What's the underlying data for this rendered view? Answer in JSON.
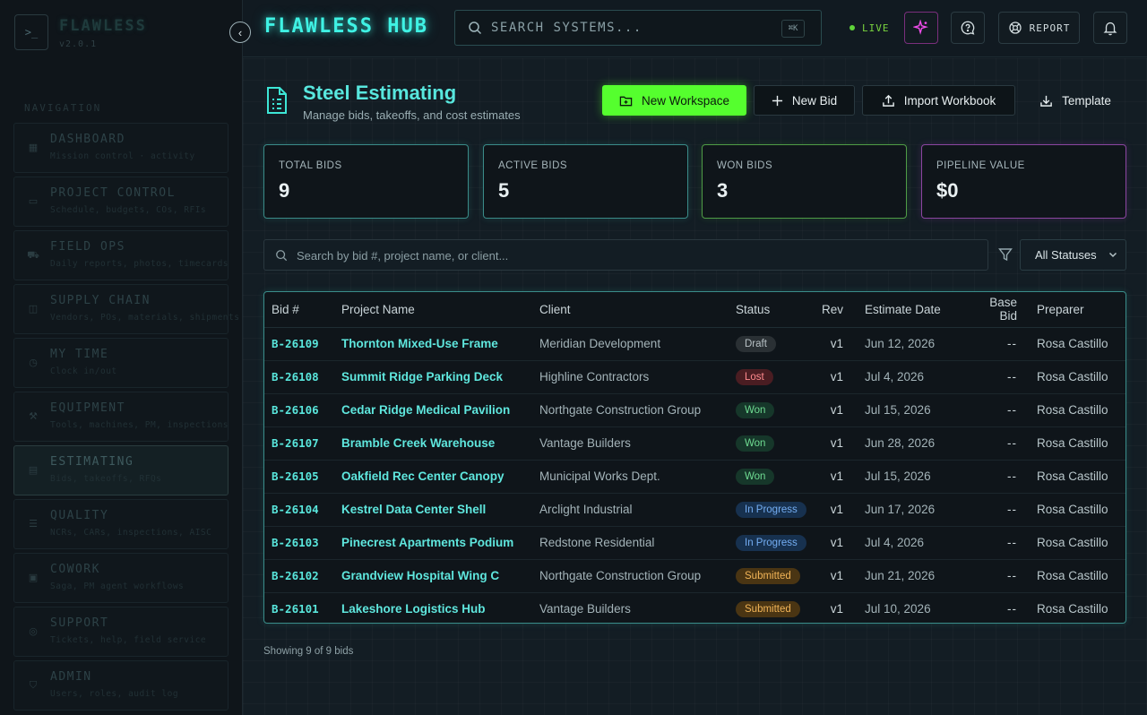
{
  "sidebar": {
    "brand_glyph": ">_",
    "brand_name": "FLAWLESS",
    "version": "v2.0.1",
    "collapse_glyph": "‹",
    "nav_heading": "NAVIGATION",
    "items": [
      {
        "label": "DASHBOARD",
        "sub": "Mission control · activity",
        "icon": "grid-icon"
      },
      {
        "label": "PROJECT CONTROL",
        "sub": "Schedule, budgets, COs, RFIs",
        "icon": "folder-icon"
      },
      {
        "label": "FIELD OPS",
        "sub": "Daily reports, photos, timecards",
        "icon": "truck-icon"
      },
      {
        "label": "SUPPLY CHAIN",
        "sub": "Vendors, POs, materials, shipments",
        "icon": "box-icon"
      },
      {
        "label": "MY TIME",
        "sub": "Clock in/out",
        "icon": "clock-icon"
      },
      {
        "label": "EQUIPMENT",
        "sub": "Tools, machines, PM, inspections",
        "icon": "wrench-icon"
      },
      {
        "label": "ESTIMATING",
        "sub": "Bids, takeoffs, RFQs",
        "icon": "document-icon"
      },
      {
        "label": "QUALITY",
        "sub": "NCRs, CARs, inspections, AISC",
        "icon": "checklist-icon"
      },
      {
        "label": "COWORK",
        "sub": "Saga, PM agent workflows",
        "icon": "briefcase-icon"
      },
      {
        "label": "SUPPORT",
        "sub": "Tickets, help, field service",
        "icon": "lifebuoy-icon"
      },
      {
        "label": "ADMIN",
        "sub": "Users, roles, audit log",
        "icon": "shield-icon"
      }
    ]
  },
  "topbar": {
    "title": "FLAWLESS HUB",
    "search_placeholder": "SEARCH SYSTEMS...",
    "shortcut": "⌘K",
    "live_label": "LIVE",
    "report_label": "REPORT"
  },
  "page": {
    "title": "Steel Estimating",
    "subtitle": "Manage bids, takeoffs, and cost estimates",
    "actions": {
      "new_workspace": "New Workspace",
      "new_bid": "New Bid",
      "import_workbook": "Import Workbook",
      "template": "Template"
    }
  },
  "stats": [
    {
      "label": "TOTAL BIDS",
      "value": "9",
      "accent": "#3fd6cc"
    },
    {
      "label": "ACTIVE BIDS",
      "value": "5",
      "accent": "#3fd6cc"
    },
    {
      "label": "WON BIDS",
      "value": "3",
      "accent": "#5ee04a"
    },
    {
      "label": "PIPELINE VALUE",
      "value": "$0",
      "accent": "#c64ff0"
    }
  ],
  "filters": {
    "search_placeholder": "Search by bid #, project name, or client...",
    "status_selected": "All Statuses"
  },
  "table": {
    "columns": [
      "Bid #",
      "Project Name",
      "Client",
      "Status",
      "Rev",
      "Estimate Date",
      "Base Bid",
      "Preparer"
    ],
    "rows": [
      {
        "bid": "B-26109",
        "project": "Thornton Mixed-Use Frame",
        "client": "Meridian Development",
        "status": "Draft",
        "status_class": "b-draft",
        "rev": "v1",
        "date": "Jun 12, 2026",
        "base": "--",
        "preparer": "Rosa Castillo"
      },
      {
        "bid": "B-26108",
        "project": "Summit Ridge Parking Deck",
        "client": "Highline Contractors",
        "status": "Lost",
        "status_class": "b-lost",
        "rev": "v1",
        "date": "Jul 4, 2026",
        "base": "--",
        "preparer": "Rosa Castillo"
      },
      {
        "bid": "B-26106",
        "project": "Cedar Ridge Medical Pavilion",
        "client": "Northgate Construction Group",
        "status": "Won",
        "status_class": "b-won",
        "rev": "v1",
        "date": "Jul 15, 2026",
        "base": "--",
        "preparer": "Rosa Castillo"
      },
      {
        "bid": "B-26107",
        "project": "Bramble Creek Warehouse",
        "client": "Vantage Builders",
        "status": "Won",
        "status_class": "b-won",
        "rev": "v1",
        "date": "Jun 28, 2026",
        "base": "--",
        "preparer": "Rosa Castillo"
      },
      {
        "bid": "B-26105",
        "project": "Oakfield Rec Center Canopy",
        "client": "Municipal Works Dept.",
        "status": "Won",
        "status_class": "b-won",
        "rev": "v1",
        "date": "Jul 15, 2026",
        "base": "--",
        "preparer": "Rosa Castillo"
      },
      {
        "bid": "B-26104",
        "project": "Kestrel Data Center Shell",
        "client": "Arclight Industrial",
        "status": "In Progress",
        "status_class": "b-progress",
        "rev": "v1",
        "date": "Jun 17, 2026",
        "base": "--",
        "preparer": "Rosa Castillo"
      },
      {
        "bid": "B-26103",
        "project": "Pinecrest Apartments Podium",
        "client": "Redstone Residential",
        "status": "In Progress",
        "status_class": "b-progress",
        "rev": "v1",
        "date": "Jul 4, 2026",
        "base": "--",
        "preparer": "Rosa Castillo"
      },
      {
        "bid": "B-26102",
        "project": "Grandview Hospital Wing C",
        "client": "Northgate Construction Group",
        "status": "Submitted",
        "status_class": "b-submitted",
        "rev": "v1",
        "date": "Jun 21, 2026",
        "base": "--",
        "preparer": "Rosa Castillo"
      },
      {
        "bid": "B-26101",
        "project": "Lakeshore Logistics Hub",
        "client": "Vantage Builders",
        "status": "Submitted",
        "status_class": "b-submitted",
        "rev": "v1",
        "date": "Jul 10, 2026",
        "base": "--",
        "preparer": "Rosa Castillo"
      }
    ],
    "footer": "Showing 9 of 9 bids"
  }
}
